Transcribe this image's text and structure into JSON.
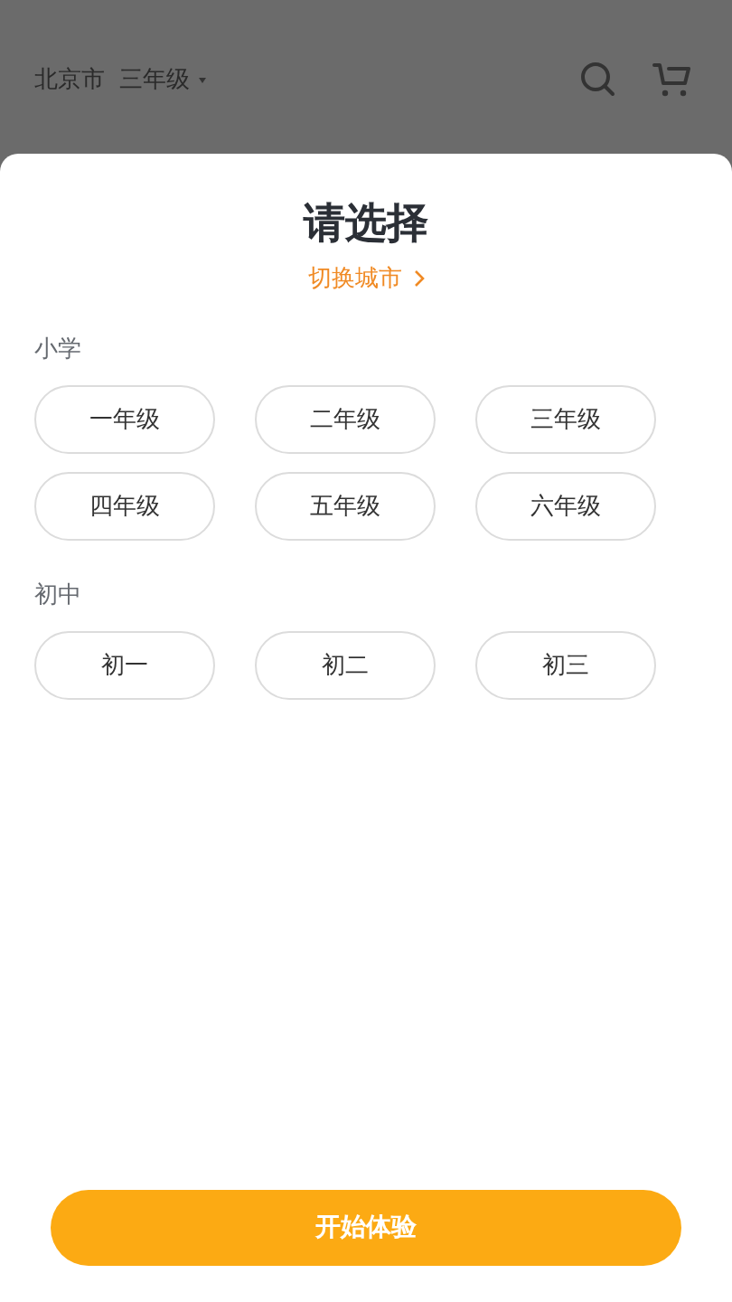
{
  "header": {
    "city": "北京市",
    "grade": "三年级"
  },
  "sheet": {
    "title": "请选择",
    "switch_link": "切换城市",
    "sections": [
      {
        "label": "小学",
        "options": [
          {
            "label": "一年级",
            "selected": false
          },
          {
            "label": "二年级",
            "selected": false
          },
          {
            "label": "三年级",
            "selected": false
          },
          {
            "label": "四年级",
            "selected": false
          },
          {
            "label": "五年级",
            "selected": false
          },
          {
            "label": "六年级",
            "selected": false
          }
        ]
      },
      {
        "label": "初中",
        "options": [
          {
            "label": "初一",
            "selected": false
          },
          {
            "label": "初二",
            "selected": false
          },
          {
            "label": "初三",
            "selected": false
          }
        ]
      }
    ],
    "start_button": "开始体验"
  }
}
